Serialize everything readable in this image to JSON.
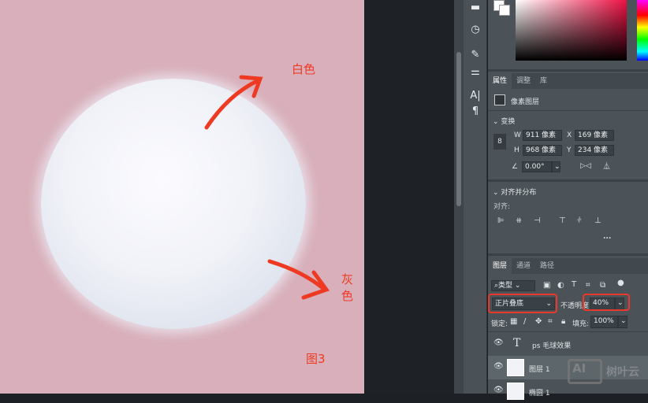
{
  "canvas": {
    "label_white": "白色",
    "label_gray": "灰色",
    "figure_label": "图3",
    "accent": "#ee3a22"
  },
  "properties": {
    "tabs": [
      "属性",
      "调整",
      "库"
    ],
    "layer_kind": "像素图层",
    "transform_title": "变换",
    "w_label": "W",
    "w_value": "911 像素",
    "x_label": "X",
    "x_value": "169 像素",
    "h_label": "H",
    "h_value": "968 像素",
    "y_label": "Y",
    "y_value": "234 像素",
    "angle_value": "0.00°",
    "align_title": "对齐并分布",
    "align_label": "对齐:",
    "more": "..."
  },
  "layers": {
    "tabs": [
      "图层",
      "通道",
      "路径"
    ],
    "filter": "类型",
    "blend_mode": "正片叠底",
    "opacity_label": "不透明度:",
    "opacity_value": "40%",
    "lock_label": "锁定:",
    "fill_label": "填充:",
    "fill_value": "100%",
    "items": [
      {
        "name": "ps 毛球效果",
        "type": "text"
      },
      {
        "name": "图层 1",
        "type": "pixel"
      },
      {
        "name": "椭圆 1",
        "type": "pixel"
      }
    ]
  },
  "watermark": {
    "logo": "AI",
    "text": "树叶云"
  }
}
